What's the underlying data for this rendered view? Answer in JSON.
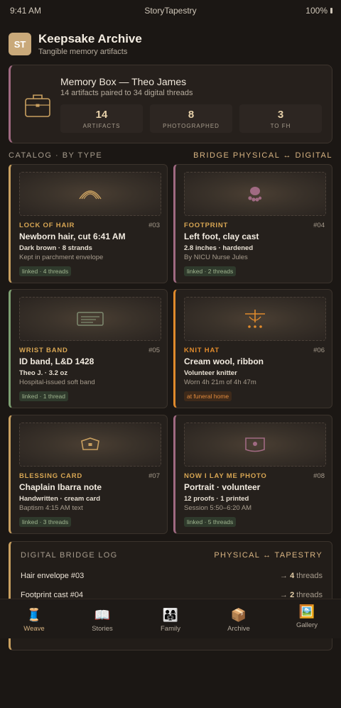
{
  "status": {
    "time": "9:41 AM",
    "app": "StoryTapestry",
    "battery": "100%"
  },
  "header": {
    "avatar": "ST",
    "title": "Keepsake Archive",
    "subtitle": "Tangible memory artifacts"
  },
  "box": {
    "title": "Memory Box — Theo James",
    "subtitle": "14 artifacts paired to 34 digital threads",
    "stats": [
      {
        "value": "14",
        "label": "ARTIFACTS"
      },
      {
        "value": "8",
        "label": "PHOTOGRAPHED"
      },
      {
        "value": "3",
        "label": "TO FH"
      }
    ]
  },
  "catalog": {
    "left": "CATALOG · BY TYPE",
    "right": "BRIDGE PHYSICAL ↔ DIGITAL"
  },
  "cards": [
    {
      "type": "LOCK OF HAIR",
      "num": "#03",
      "title": "Newborn hair, cut 6:41 AM",
      "meta": "Dark brown · 8 strands",
      "note": "Kept in parchment envelope",
      "tag": "linked · 4 threads",
      "accent": "#c9a060",
      "type_color": "#d8a653",
      "icon": "hair-arc-icon"
    },
    {
      "type": "FOOTPRINT",
      "num": "#04",
      "title": "Left foot, clay cast",
      "meta": "2.8 inches · hardened",
      "note": "By NICU Nurse Jules",
      "tag": "linked · 2 threads",
      "accent": "#a06a82",
      "type_color": "#d8a653",
      "icon": "footprint-icon"
    },
    {
      "type": "WRIST BAND",
      "num": "#05",
      "title": "ID band, L&D 1428",
      "meta": "Theo J. · 3.2 oz",
      "note": "Hospital-issued soft band",
      "tag": "linked · 1 thread",
      "accent": "#7ea072",
      "type_color": "#d8a653",
      "icon": "wristband-icon"
    },
    {
      "type": "KNIT HAT",
      "num": "#06",
      "title": "Cream wool, ribbon",
      "meta": "Volunteer knitter",
      "note": "Worn 4h 21m of 4h 47m",
      "tag": "at funeral home",
      "accent": "#e08a2c",
      "type_color": "#e08a2c",
      "icon": "knit-hat-icon"
    },
    {
      "type": "BLESSING CARD",
      "num": "#07",
      "title": "Chaplain Ibarra note",
      "meta": "Handwritten · cream card",
      "note": "Baptism 4:15 AM text",
      "tag": "linked · 3 threads",
      "accent": "#c9a060",
      "type_color": "#d8a653",
      "icon": "card-icon"
    },
    {
      "type": "NOW I LAY ME PHOTO",
      "num": "#08",
      "title": "Portrait · volunteer",
      "meta": "12 proofs · 1 printed",
      "note": "Session 5:50–6:20 AM",
      "tag": "linked · 5 threads",
      "accent": "#a06a82",
      "type_color": "#d8a653",
      "icon": "camera-icon"
    }
  ],
  "log": {
    "title": "DIGITAL BRIDGE LOG",
    "right": "PHYSICAL ↔ TAPESTRY",
    "rows": [
      {
        "label": "Hair envelope #03",
        "arrow": "→",
        "count": "4",
        "unit": "threads"
      },
      {
        "label": "Footprint cast #04",
        "arrow": "→",
        "count": "2",
        "unit": "threads"
      }
    ]
  },
  "tabs": [
    {
      "icon": "🧵",
      "label": "Weave",
      "name": "thread-icon",
      "active": true
    },
    {
      "icon": "📖",
      "label": "Stories",
      "name": "book-icon"
    },
    {
      "icon": "👨‍👩‍👧",
      "label": "Family",
      "name": "family-icon"
    },
    {
      "icon": "📦",
      "label": "Archive",
      "name": "box-icon"
    },
    {
      "icon": "🖼️",
      "label": "Gallery",
      "name": "picture-icon"
    }
  ]
}
